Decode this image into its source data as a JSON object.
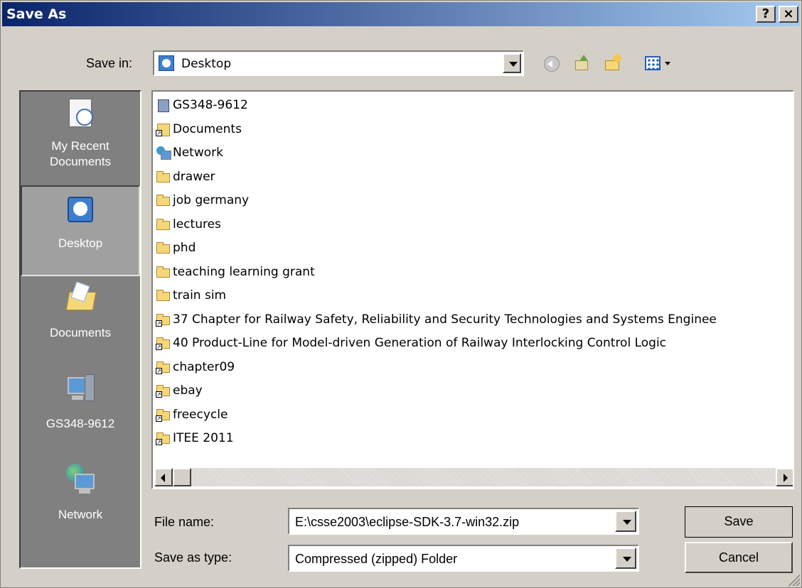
{
  "window": {
    "title": "Save As",
    "help_label": "?",
    "close_label": "×"
  },
  "toolbar": {
    "save_in_label": "Save in:",
    "save_in_value": "Desktop"
  },
  "places": [
    {
      "label": "My Recent\nDocuments",
      "icon": "recent-documents-icon"
    },
    {
      "label": "Desktop",
      "icon": "desktop-icon",
      "selected": true
    },
    {
      "label": "Documents",
      "icon": "documents-folder-icon"
    },
    {
      "label": "GS348-9612",
      "icon": "computer-icon"
    },
    {
      "label": "Network",
      "icon": "network-icon"
    }
  ],
  "files": [
    {
      "name": "GS348-9612",
      "type": "computer"
    },
    {
      "name": "Documents",
      "type": "library"
    },
    {
      "name": "Network",
      "type": "network"
    },
    {
      "name": "drawer",
      "type": "folder"
    },
    {
      "name": "job germany",
      "type": "folder"
    },
    {
      "name": "lectures",
      "type": "folder"
    },
    {
      "name": "phd",
      "type": "folder"
    },
    {
      "name": "teaching learning grant",
      "type": "folder"
    },
    {
      "name": "train sim",
      "type": "folder"
    },
    {
      "name": "37 Chapter for Railway Safety, Reliability and Security Technologies and Systems Enginee",
      "type": "folder-shortcut"
    },
    {
      "name": "40 Product-Line for Model-driven Generation of Railway Interlocking Control Logic",
      "type": "folder-shortcut"
    },
    {
      "name": "chapter09",
      "type": "folder-shortcut"
    },
    {
      "name": "ebay",
      "type": "folder-shortcut"
    },
    {
      "name": "freecycle",
      "type": "folder-shortcut"
    },
    {
      "name": "ITEE 2011",
      "type": "folder-shortcut"
    }
  ],
  "form": {
    "file_name_label": "File name:",
    "file_name_value": "E:\\csse2003\\eclipse-SDK-3.7-win32.zip",
    "save_type_label": "Save as type:",
    "save_type_value": "Compressed (zipped) Folder"
  },
  "buttons": {
    "save": "Save",
    "cancel": "Cancel"
  }
}
